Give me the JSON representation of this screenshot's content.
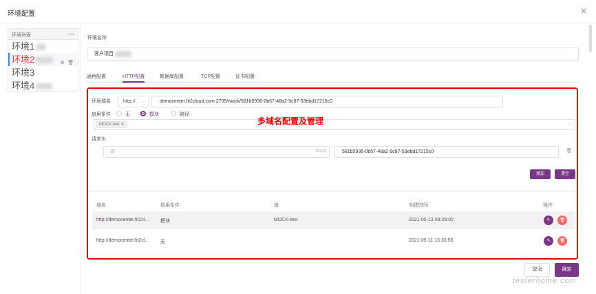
{
  "dialog": {
    "title": "环境配置",
    "close_icon": "close-icon"
  },
  "sidebar": {
    "header_label": "环境列表",
    "collapse_label": "—",
    "items": [
      {
        "label": "环境1"
      },
      {
        "label": "环境2"
      },
      {
        "label": "环境3"
      },
      {
        "label": "环境4"
      }
    ],
    "item_action_icons": [
      "copy-icon",
      "delete-icon"
    ],
    "item_actions_text": [
      "⧉",
      "🗑"
    ]
  },
  "main": {
    "env_name_label": "环境名称",
    "env_name_value": "客户项目",
    "tabs": [
      {
        "label": "通用配置"
      },
      {
        "label": "HTTP配置"
      },
      {
        "label": "数据库配置"
      },
      {
        "label": "TCP配置"
      },
      {
        "label": "证书配置"
      }
    ],
    "active_tab": "HTTP配置"
  },
  "http": {
    "domain_label": "环境域名",
    "protocol": "http://",
    "domain_value": "democenter.fit2cloud.com:2705/mock/581b5936-0b57-48a2-9c87-53ebd17215c0",
    "condition_label": "启用条件",
    "radio_options": [
      "无",
      "模块",
      "路径"
    ],
    "radio_selected": "模块",
    "condition_tag": "MOCK-test",
    "annotation": "多域名配置及管理",
    "headers_label": "请求头",
    "header_key_placeholder": "键",
    "header_key_count": "0/200",
    "header_value": "581b5936-0b57-48a2-9c87-53ebd17215c0",
    "add_button": "添加",
    "clear_button": "清空",
    "table": {
      "headers": [
        "域名",
        "启用条件",
        "值",
        "创建时间",
        "操作"
      ],
      "rows": [
        {
          "domain": "http://democenter.fit2cl...",
          "condition": "模块",
          "value": "MOCK-test",
          "created": "2021-05-13 09:29:02"
        },
        {
          "domain": "http://democenter.fit2cl...",
          "condition": "无",
          "value": "",
          "created": "2021-05-11 13:33:55"
        }
      ]
    }
  },
  "footer": {
    "cancel": "取消",
    "ok": "确定"
  },
  "watermark": "testerhome.com",
  "colors": {
    "accent": "#783887",
    "danger": "#f56c6c",
    "annotation": "#ee0000"
  }
}
